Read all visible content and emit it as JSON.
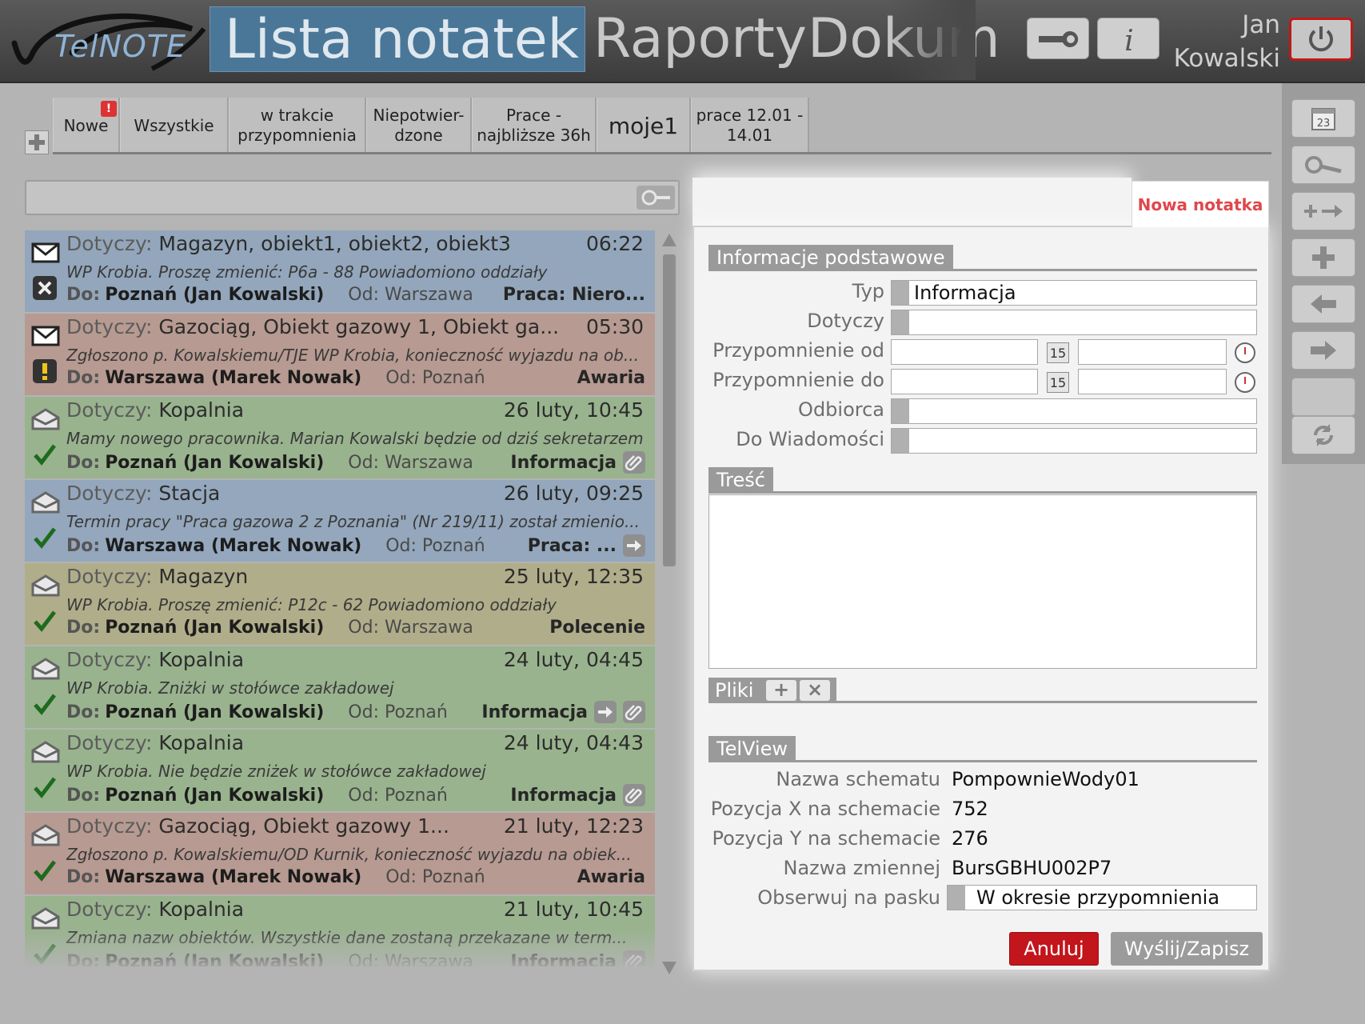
{
  "header": {
    "logo_text": "TelNOTE",
    "nav_tabs": [
      "Lista notatek",
      "Raporty",
      "Dokum"
    ],
    "user_first": "Jan",
    "user_last": "Kowalski"
  },
  "filters": {
    "tabs": [
      "Nowe",
      "Wszystkie",
      "w trakcie przypomnienia",
      "Niepotwier-dzone",
      "Prace - najbliższe 36h",
      "moje1",
      "prace 12.01 - 14.01"
    ],
    "alert_badge": "!"
  },
  "search": {
    "placeholder": "",
    "value": ""
  },
  "list_labels": {
    "regarding": "Dotyczy:",
    "to": "Do:",
    "from": "Od:"
  },
  "notes": [
    {
      "status": "unread",
      "state": "rejected",
      "color": "#93a6bb",
      "subject": "Magazyn, obiekt1, obiekt2, obiekt3",
      "time": "06:22",
      "text": "WP Krobia.  Proszę zmienić: P6a - 88  Powiadomiono oddziały",
      "to": "Poznań (Jan Kowalski)",
      "from": "Warszawa",
      "type": "Praca: Niero..."
    },
    {
      "status": "unread",
      "state": "warning",
      "color": "#b79a91",
      "subject": "Gazociąg, Obiekt gazowy 1, Obiekt ga...",
      "time": "05:30",
      "text": "Zgłoszono p. Kowalskiemu/TJE WP Krobia, konieczność wyjazdu na ob...",
      "to": "Warszawa (Marek Nowak)",
      "from": "Poznań",
      "type": "Awaria"
    },
    {
      "status": "read",
      "state": "confirmed",
      "color": "#99b38e",
      "subject": "Kopalnia",
      "time": "26 luty, 10:45",
      "text": "Mamy nowego pracownika. Marian Kowalski będzie od dziś sekretarzem",
      "to": "Poznań (Jan Kowalski)",
      "from": "Warszawa",
      "type": "Informacja",
      "attachment": true
    },
    {
      "status": "read",
      "state": "confirmed",
      "color": "#94a7bc",
      "subject": "Stacja",
      "time": "26 luty, 09:25",
      "text": "Termin pracy \"Praca gazowa 2 z Poznania\" (Nr 219/11) został zmienio...",
      "to": "Warszawa (Marek Nowak)",
      "from": "Poznań",
      "type": "Praca: ...",
      "forward": true
    },
    {
      "status": "read",
      "state": "confirmed",
      "color": "#b0ad8a",
      "subject": "Magazyn",
      "time": "25 luty, 12:35",
      "text": "WP Krobia.  Proszę zmienić: P12c - 62  Powiadomiono oddziały",
      "to": "Poznań (Jan Kowalski)",
      "from": "Warszawa",
      "type": "Polecenie"
    },
    {
      "status": "read",
      "state": "confirmed",
      "color": "#99b38e",
      "subject": "Kopalnia",
      "time": "24 luty, 04:45",
      "text": "WP Krobia.  Zniżki w stołówce zakładowej",
      "to": "Poznań (Jan Kowalski)",
      "from": "Poznań",
      "type": "Informacja",
      "forward": true,
      "attachment": true
    },
    {
      "status": "read",
      "state": "confirmed",
      "color": "#99b38e",
      "subject": "Kopalnia",
      "time": "24 luty, 04:43",
      "text": "WP Krobia.  Nie będzie zniżek w stołówce zakładowej",
      "to": "Poznań (Jan Kowalski)",
      "from": "Poznań",
      "type": "Informacja",
      "attachment": true
    },
    {
      "status": "read",
      "state": "confirmed",
      "color": "#b79a91",
      "subject": "Gazociąg, Obiekt gazowy 1...",
      "time": "21 luty, 12:23",
      "text": "Zgłoszono p. Kowalskiemu/OD Kurnik, konieczność wyjazdu na obiek...",
      "to": "Warszawa (Marek Nowak)",
      "from": "Poznań",
      "type": "Awaria"
    },
    {
      "status": "read",
      "state": "confirmed",
      "color": "#99b38e",
      "subject": "Kopalnia",
      "time": "21 luty, 10:45",
      "text": "Zmiana nazw obiektów. Wszystkie dane zostaną przekazane w term...",
      "to": "Poznań (Jan Kowalski)",
      "from": "Warszawa",
      "type": "Informacja",
      "attachment": true
    }
  ],
  "form": {
    "tab_label": "Nowa notatka",
    "basic_section": "Informacje podstawowe",
    "labels": {
      "type": "Typ",
      "regarding": "Dotyczy",
      "remind_from": "Przypomnienie od",
      "remind_to": "Przypomnienie do",
      "recipient": "Odbiorca",
      "cc": "Do Wiadomości"
    },
    "type_value": "Informacja",
    "calendar_day": "15",
    "content_section": "Treść",
    "files_section": "Pliki",
    "files_add": "+",
    "files_remove": "×",
    "telview_section": "TelView",
    "telview": {
      "schema_name_label": "Nazwa schematu",
      "schema_name": "PompownieWody01",
      "pos_x_label": "Pozycja X na schemacie",
      "pos_x": "752",
      "pos_y_label": "Pozycja Y na schemacie",
      "pos_y": "276",
      "variable_label": "Nazwa zmiennej",
      "variable": "BursGBHU002P7",
      "observe_label": "Obserwuj na pasku",
      "observe": "W okresie przypomnienia"
    },
    "cancel_label": "Anuluj",
    "save_label": "Wyślij/Zapisz"
  },
  "toolbar": {
    "calendar_day": "23",
    "icons": [
      "calendar-icon",
      "search-icon",
      "add-link-icon",
      "add-icon",
      "back-icon",
      "forward-icon",
      "blank-button",
      "refresh-icon"
    ]
  }
}
